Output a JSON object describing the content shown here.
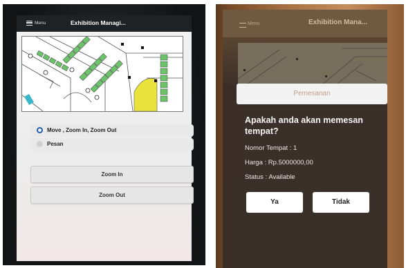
{
  "left": {
    "appbar": {
      "menu_label": "Menu",
      "title": "Exhibition Managi..."
    },
    "mode_options": [
      {
        "label": "Move , Zoom In, Zoom Out",
        "selected": true
      },
      {
        "label": "Pesan",
        "selected": false
      }
    ],
    "buttons": {
      "zoom_in": "Zoom In",
      "zoom_out": "Zoom Out"
    },
    "colors": {
      "booth": "#6cc46a",
      "accent": "#1e5fb0",
      "appbar": "#1f2224"
    }
  },
  "right": {
    "appbar": {
      "menu_label": "Menu",
      "title": "Exhibition Mana..."
    },
    "dialog": {
      "title": "Pemesanan",
      "question": "Apakah anda akan memesan tempat?",
      "booth_number": "Nomor Tempat : 1",
      "price": "Harga : Rp.5000000,00",
      "status": "Status : Available",
      "confirm_label": "Ya",
      "cancel_label": "Tidak"
    }
  }
}
